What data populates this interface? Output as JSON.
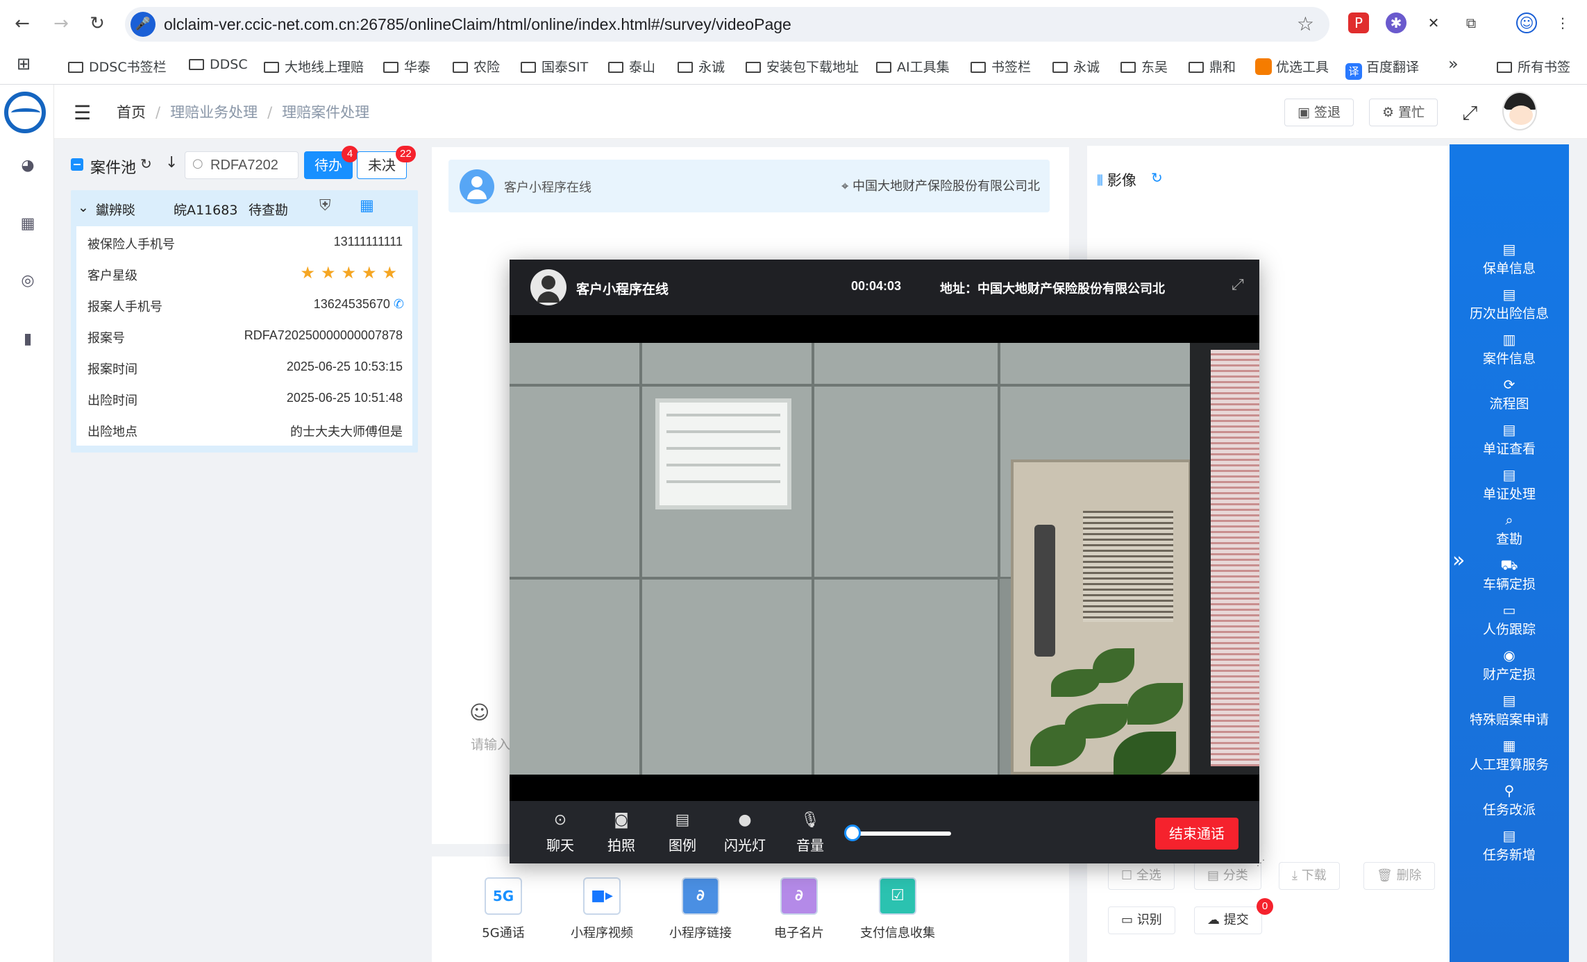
{
  "browser": {
    "url": "olclaim-ver.ccic-net.com.cn:26785/onlineClaim/html/online/index.html#/survey/videoPage",
    "bookmarks": [
      "DDSC书签栏",
      "DDSC",
      "大地线上理赔",
      "华泰",
      "农险",
      "国泰SIT",
      "泰山",
      "永诚",
      "安装包下载地址",
      "AI工具集",
      "书签栏",
      "永诚",
      "东吴",
      "鼎和",
      "优选工具",
      "百度翻译"
    ],
    "more": "»",
    "all_bookmarks": "所有书签"
  },
  "header": {
    "breadcrumb": [
      "首页",
      "理赔业务处理",
      "理赔案件处理"
    ],
    "sign_out": "签退",
    "busy": "置忙"
  },
  "case_pool": {
    "title": "案件池",
    "search_value": "RDFA7202",
    "todo_label": "待办",
    "todo_count": "4",
    "undecided_label": "未决",
    "undecided_count": "22",
    "case": {
      "name": "钀辨晱",
      "plate": "皖A11683",
      "status": "待查勘",
      "rating": 5,
      "rows": [
        {
          "label": "被保险人手机号",
          "value": "13111111111"
        },
        {
          "label": "客户星级",
          "value": ""
        },
        {
          "label": "报案人手机号",
          "value": "13624535670"
        },
        {
          "label": "报案号",
          "value": "RDFA720250000000007878"
        },
        {
          "label": "报案时间",
          "value": "2025-06-25 10:53:15"
        },
        {
          "label": "出险时间",
          "value": "2025-06-25 10:51:48"
        },
        {
          "label": "出险地点",
          "value": "的士大夫大师傅但是"
        }
      ]
    }
  },
  "chat": {
    "title": "客户小程序在线",
    "location": "中国大地财产保险股份有限公司北",
    "input_placeholder": "请输入"
  },
  "tools": [
    "5G通话",
    "小程序视频",
    "小程序链接",
    "电子名片",
    "支付信息收集"
  ],
  "image_panel": {
    "title": "影像",
    "actions": [
      "全选",
      "分类",
      "下载",
      "删除"
    ],
    "recognize": "识别",
    "submit": "提交",
    "submit_count": "0"
  },
  "rail": [
    "保单信息",
    "历次出险信息",
    "案件信息",
    "流程图",
    "单证查看",
    "单证处理",
    "查勘",
    "车辆定损",
    "人伤跟踪",
    "财产定损",
    "特殊赔案申请",
    "人工理算服务",
    "任务改派",
    "任务新增"
  ],
  "video_call": {
    "title": "客户小程序在线",
    "timer": "00:04:03",
    "address": "地址：中国大地财产保险股份有限公司北",
    "controls": [
      "聊天",
      "拍照",
      "图例",
      "闪光灯",
      "音量"
    ],
    "volume_fraction": 0.0,
    "end_call": "结束通话"
  },
  "colors": {
    "primary": "#1890ff",
    "rail": "#1478e6",
    "danger": "#f5222d",
    "star": "#f5a623"
  }
}
